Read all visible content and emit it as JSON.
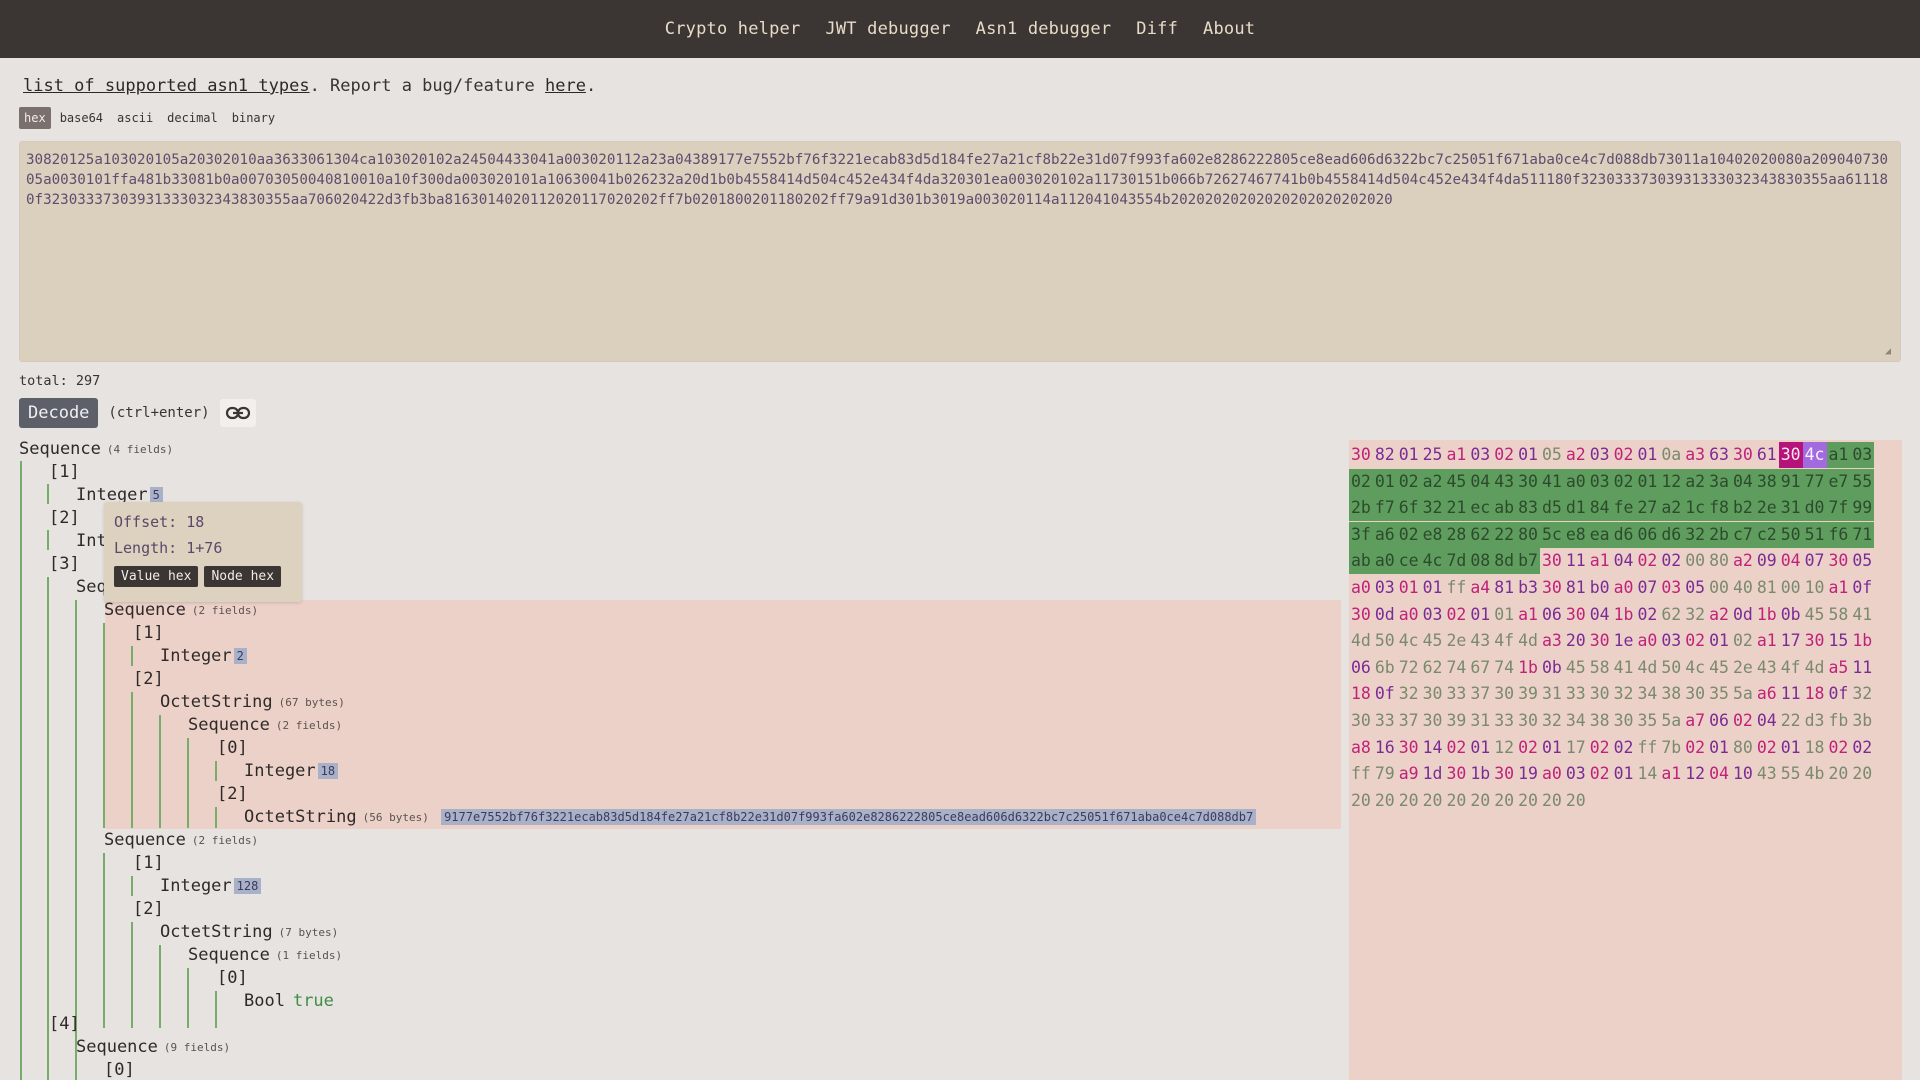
{
  "nav": {
    "items": [
      "Crypto helper",
      "JWT debugger",
      "Asn1 debugger",
      "Diff",
      "About"
    ]
  },
  "info": {
    "types_link": "list of supported asn1 types",
    "middle": ". Report a bug/feature ",
    "here_link": "here",
    "end": "."
  },
  "formats": [
    "hex",
    "base64",
    "ascii",
    "decimal",
    "binary"
  ],
  "input": {
    "value": "30820125a103020105a20302010aa3633061304ca103020102a24504433041a003020112a23a04389177e7552bf76f3221ecab83d5d184fe27a21cf8b22e31d07f993fa602e8286222805ce8ead606d6322bc7c25051f671aba0ce4c7d088db73011a10402020080a20904073005a0030101ffa481b33081b0a00703050040810010a10f300da003020101a10630041b026232a20d1b0b4558414d504c452e434f4da320301ea003020102a11730151b066b72627467741b0b4558414d504c452e434f4da511180f32303337303931333032343830355aa611180f32303337303931333032343830355aa706020422d3fb3ba8163014020112020117020202ff7b0201800201180202ff79a91d301b3019a003020114a112041043554b20202020202020202020202020"
  },
  "total": "total: 297",
  "decode": {
    "label": "Decode",
    "shortcut": "(ctrl+enter)"
  },
  "tooltip": {
    "offset": "Offset: 18",
    "length": "Length: 1+76",
    "value_hex": "Value hex",
    "node_hex": "Node hex"
  },
  "tree": {
    "r0": "Sequence",
    "r0m": "(4 fields)",
    "r1": "[1]",
    "r2": "Integer",
    "r2v": "5",
    "r3": "[2]",
    "r4": "Int",
    "r5": "[3]",
    "r6": "Seq",
    "r7": "Sequence",
    "r7m": "(2 fields)",
    "r8": "[1]",
    "r9": "Integer",
    "r9v": "2",
    "r10": "[2]",
    "r11": "OctetString",
    "r11m": "(67 bytes)",
    "r12": "Sequence",
    "r12m": "(2 fields)",
    "r13": "[0]",
    "r14": "Integer",
    "r14v": "18",
    "r15": "[2]",
    "r16": "OctetString",
    "r16m": "(56 bytes)",
    "r16v": "9177e7552bf76f3221ecab83d5d184fe27a21cf8b22e31d07f993fa602e8286222805ce8ead606d6322bc7c25051f671aba0ce4c7d088db7",
    "r17": "Sequence",
    "r17m": "(2 fields)",
    "r18": "[1]",
    "r19": "Integer",
    "r19v": "128",
    "r20": "[2]",
    "r21": "OctetString",
    "r21m": "(7 bytes)",
    "r22": "Sequence",
    "r22m": "(1 fields)",
    "r23": "[0]",
    "r24": "Bool",
    "r24v": "true",
    "r25": "[4]",
    "r26": "Sequence",
    "r26m": "(9 fields)",
    "r27": "[0]"
  },
  "hex": [
    [
      [
        "30",
        "c1"
      ],
      [
        "82",
        "c2"
      ],
      [
        "01",
        "c2"
      ],
      [
        "25",
        "c2"
      ],
      [
        "a1",
        "c1"
      ],
      [
        "03",
        "c2"
      ],
      [
        "02",
        "c1"
      ],
      [
        "01",
        "c2"
      ],
      [
        "05",
        "c4"
      ],
      [
        "a2",
        "c1"
      ],
      [
        "03",
        "c2"
      ],
      [
        "02",
        "c1"
      ],
      [
        "01",
        "c2"
      ],
      [
        "0a",
        "c4"
      ],
      [
        "a3",
        "c1"
      ],
      [
        "63",
        "c2"
      ],
      [
        "30",
        "c1"
      ],
      [
        "61",
        "c2"
      ],
      [
        "30",
        "sel1"
      ],
      [
        "4c",
        "sel2"
      ],
      [
        "a1",
        "g"
      ],
      [
        "03",
        "g"
      ]
    ],
    [
      [
        "02",
        "g"
      ],
      [
        "01",
        "g"
      ],
      [
        "02",
        "g"
      ],
      [
        "a2",
        "g"
      ],
      [
        "45",
        "g"
      ],
      [
        "04",
        "g"
      ],
      [
        "43",
        "g"
      ],
      [
        "30",
        "g"
      ],
      [
        "41",
        "g"
      ],
      [
        "a0",
        "g"
      ],
      [
        "03",
        "g"
      ],
      [
        "02",
        "g"
      ],
      [
        "01",
        "g"
      ],
      [
        "12",
        "g"
      ],
      [
        "a2",
        "g"
      ],
      [
        "3a",
        "g"
      ],
      [
        "04",
        "g"
      ],
      [
        "38",
        "g"
      ],
      [
        "91",
        "g"
      ],
      [
        "77",
        "g"
      ],
      [
        "e7",
        "g"
      ],
      [
        "55",
        "g"
      ]
    ],
    [
      [
        "2b",
        "g"
      ],
      [
        "f7",
        "g"
      ],
      [
        "6f",
        "g"
      ],
      [
        "32",
        "g"
      ],
      [
        "21",
        "g"
      ],
      [
        "ec",
        "g"
      ],
      [
        "ab",
        "g"
      ],
      [
        "83",
        "g"
      ],
      [
        "d5",
        "g"
      ],
      [
        "d1",
        "g"
      ],
      [
        "84",
        "g"
      ],
      [
        "fe",
        "g"
      ],
      [
        "27",
        "g"
      ],
      [
        "a2",
        "g"
      ],
      [
        "1c",
        "g"
      ],
      [
        "f8",
        "g"
      ],
      [
        "b2",
        "g"
      ],
      [
        "2e",
        "g"
      ],
      [
        "31",
        "g"
      ],
      [
        "d0",
        "g"
      ],
      [
        "7f",
        "g"
      ],
      [
        "99",
        "g"
      ]
    ],
    [
      [
        "3f",
        "g"
      ],
      [
        "a6",
        "g"
      ],
      [
        "02",
        "g"
      ],
      [
        "e8",
        "g"
      ],
      [
        "28",
        "g"
      ],
      [
        "62",
        "g"
      ],
      [
        "22",
        "g"
      ],
      [
        "80",
        "g"
      ],
      [
        "5c",
        "g"
      ],
      [
        "e8",
        "g"
      ],
      [
        "ea",
        "g"
      ],
      [
        "d6",
        "g"
      ],
      [
        "06",
        "g"
      ],
      [
        "d6",
        "g"
      ],
      [
        "32",
        "g"
      ],
      [
        "2b",
        "g"
      ],
      [
        "c7",
        "g"
      ],
      [
        "c2",
        "g"
      ],
      [
        "50",
        "g"
      ],
      [
        "51",
        "g"
      ],
      [
        "f6",
        "g"
      ],
      [
        "71",
        "g"
      ]
    ],
    [
      [
        "ab",
        "g"
      ],
      [
        "a0",
        "g"
      ],
      [
        "ce",
        "g"
      ],
      [
        "4c",
        "g"
      ],
      [
        "7d",
        "g"
      ],
      [
        "08",
        "g"
      ],
      [
        "8d",
        "g"
      ],
      [
        "b7",
        "g"
      ],
      [
        "30",
        "c1"
      ],
      [
        "11",
        "c2"
      ],
      [
        "a1",
        "c1"
      ],
      [
        "04",
        "c2"
      ],
      [
        "02",
        "c1"
      ],
      [
        "02",
        "c2"
      ],
      [
        "00",
        "c4"
      ],
      [
        "80",
        "c4"
      ],
      [
        "a2",
        "c1"
      ],
      [
        "09",
        "c2"
      ],
      [
        "04",
        "c1"
      ],
      [
        "07",
        "c2"
      ],
      [
        "30",
        "c1"
      ],
      [
        "05",
        "c2"
      ]
    ],
    [
      [
        "a0",
        "c1"
      ],
      [
        "03",
        "c2"
      ],
      [
        "01",
        "c1"
      ],
      [
        "01",
        "c2"
      ],
      [
        "ff",
        "c4"
      ],
      [
        "a4",
        "c1"
      ],
      [
        "81",
        "c2"
      ],
      [
        "b3",
        "c2"
      ],
      [
        "30",
        "c1"
      ],
      [
        "81",
        "c2"
      ],
      [
        "b0",
        "c2"
      ],
      [
        "a0",
        "c1"
      ],
      [
        "07",
        "c2"
      ],
      [
        "03",
        "c1"
      ],
      [
        "05",
        "c2"
      ],
      [
        "00",
        "c4"
      ],
      [
        "40",
        "c4"
      ],
      [
        "81",
        "c4"
      ],
      [
        "00",
        "c4"
      ],
      [
        "10",
        "c4"
      ],
      [
        "a1",
        "c1"
      ],
      [
        "0f",
        "c2"
      ]
    ],
    [
      [
        "30",
        "c1"
      ],
      [
        "0d",
        "c2"
      ],
      [
        "a0",
        "c1"
      ],
      [
        "03",
        "c2"
      ],
      [
        "02",
        "c1"
      ],
      [
        "01",
        "c2"
      ],
      [
        "01",
        "c4"
      ],
      [
        "a1",
        "c1"
      ],
      [
        "06",
        "c2"
      ],
      [
        "30",
        "c1"
      ],
      [
        "04",
        "c2"
      ],
      [
        "1b",
        "c1"
      ],
      [
        "02",
        "c2"
      ],
      [
        "62",
        "c4"
      ],
      [
        "32",
        "c4"
      ],
      [
        "a2",
        "c1"
      ],
      [
        "0d",
        "c2"
      ],
      [
        "1b",
        "c1"
      ],
      [
        "0b",
        "c2"
      ],
      [
        "45",
        "c4"
      ],
      [
        "58",
        "c4"
      ],
      [
        "41",
        "c4"
      ]
    ],
    [
      [
        "4d",
        "c4"
      ],
      [
        "50",
        "c4"
      ],
      [
        "4c",
        "c4"
      ],
      [
        "45",
        "c4"
      ],
      [
        "2e",
        "c4"
      ],
      [
        "43",
        "c4"
      ],
      [
        "4f",
        "c4"
      ],
      [
        "4d",
        "c4"
      ],
      [
        "a3",
        "c1"
      ],
      [
        "20",
        "c2"
      ],
      [
        "30",
        "c1"
      ],
      [
        "1e",
        "c2"
      ],
      [
        "a0",
        "c1"
      ],
      [
        "03",
        "c2"
      ],
      [
        "02",
        "c1"
      ],
      [
        "01",
        "c2"
      ],
      [
        "02",
        "c4"
      ],
      [
        "a1",
        "c1"
      ],
      [
        "17",
        "c2"
      ],
      [
        "30",
        "c1"
      ],
      [
        "15",
        "c2"
      ],
      [
        "1b",
        "c1"
      ]
    ],
    [
      [
        "06",
        "c2"
      ],
      [
        "6b",
        "c4"
      ],
      [
        "72",
        "c4"
      ],
      [
        "62",
        "c4"
      ],
      [
        "74",
        "c4"
      ],
      [
        "67",
        "c4"
      ],
      [
        "74",
        "c4"
      ],
      [
        "1b",
        "c1"
      ],
      [
        "0b",
        "c2"
      ],
      [
        "45",
        "c4"
      ],
      [
        "58",
        "c4"
      ],
      [
        "41",
        "c4"
      ],
      [
        "4d",
        "c4"
      ],
      [
        "50",
        "c4"
      ],
      [
        "4c",
        "c4"
      ],
      [
        "45",
        "c4"
      ],
      [
        "2e",
        "c4"
      ],
      [
        "43",
        "c4"
      ],
      [
        "4f",
        "c4"
      ],
      [
        "4d",
        "c4"
      ],
      [
        "a5",
        "c1"
      ],
      [
        "11",
        "c2"
      ]
    ],
    [
      [
        "18",
        "c1"
      ],
      [
        "0f",
        "c2"
      ],
      [
        "32",
        "c4"
      ],
      [
        "30",
        "c4"
      ],
      [
        "33",
        "c4"
      ],
      [
        "37",
        "c4"
      ],
      [
        "30",
        "c4"
      ],
      [
        "39",
        "c4"
      ],
      [
        "31",
        "c4"
      ],
      [
        "33",
        "c4"
      ],
      [
        "30",
        "c4"
      ],
      [
        "32",
        "c4"
      ],
      [
        "34",
        "c4"
      ],
      [
        "38",
        "c4"
      ],
      [
        "30",
        "c4"
      ],
      [
        "35",
        "c4"
      ],
      [
        "5a",
        "c4"
      ],
      [
        "a6",
        "c1"
      ],
      [
        "11",
        "c2"
      ],
      [
        "18",
        "c1"
      ],
      [
        "0f",
        "c2"
      ],
      [
        "32",
        "c4"
      ]
    ],
    [
      [
        "30",
        "c4"
      ],
      [
        "33",
        "c4"
      ],
      [
        "37",
        "c4"
      ],
      [
        "30",
        "c4"
      ],
      [
        "39",
        "c4"
      ],
      [
        "31",
        "c4"
      ],
      [
        "33",
        "c4"
      ],
      [
        "30",
        "c4"
      ],
      [
        "32",
        "c4"
      ],
      [
        "34",
        "c4"
      ],
      [
        "38",
        "c4"
      ],
      [
        "30",
        "c4"
      ],
      [
        "35",
        "c4"
      ],
      [
        "5a",
        "c4"
      ],
      [
        "a7",
        "c1"
      ],
      [
        "06",
        "c2"
      ],
      [
        "02",
        "c1"
      ],
      [
        "04",
        "c2"
      ],
      [
        "22",
        "c4"
      ],
      [
        "d3",
        "c4"
      ],
      [
        "fb",
        "c4"
      ],
      [
        "3b",
        "c4"
      ]
    ],
    [
      [
        "a8",
        "c1"
      ],
      [
        "16",
        "c2"
      ],
      [
        "30",
        "c1"
      ],
      [
        "14",
        "c2"
      ],
      [
        "02",
        "c1"
      ],
      [
        "01",
        "c2"
      ],
      [
        "12",
        "c4"
      ],
      [
        "02",
        "c1"
      ],
      [
        "01",
        "c2"
      ],
      [
        "17",
        "c4"
      ],
      [
        "02",
        "c1"
      ],
      [
        "02",
        "c2"
      ],
      [
        "ff",
        "c4"
      ],
      [
        "7b",
        "c4"
      ],
      [
        "02",
        "c1"
      ],
      [
        "01",
        "c2"
      ],
      [
        "80",
        "c4"
      ],
      [
        "02",
        "c1"
      ],
      [
        "01",
        "c2"
      ],
      [
        "18",
        "c4"
      ],
      [
        "02",
        "c1"
      ],
      [
        "02",
        "c2"
      ]
    ],
    [
      [
        "ff",
        "c4"
      ],
      [
        "79",
        "c4"
      ],
      [
        "a9",
        "c1"
      ],
      [
        "1d",
        "c2"
      ],
      [
        "30",
        "c1"
      ],
      [
        "1b",
        "c2"
      ],
      [
        "30",
        "c1"
      ],
      [
        "19",
        "c2"
      ],
      [
        "a0",
        "c1"
      ],
      [
        "03",
        "c2"
      ],
      [
        "02",
        "c1"
      ],
      [
        "01",
        "c2"
      ],
      [
        "14",
        "c4"
      ],
      [
        "a1",
        "c1"
      ],
      [
        "12",
        "c2"
      ],
      [
        "04",
        "c1"
      ],
      [
        "10",
        "c2"
      ],
      [
        "43",
        "c4"
      ],
      [
        "55",
        "c4"
      ],
      [
        "4b",
        "c4"
      ],
      [
        "20",
        "c4"
      ],
      [
        "20",
        "c4"
      ]
    ],
    [
      [
        "20",
        "c4"
      ],
      [
        "20",
        "c4"
      ],
      [
        "20",
        "c4"
      ],
      [
        "20",
        "c4"
      ],
      [
        "20",
        "c4"
      ],
      [
        "20",
        "c4"
      ],
      [
        "20",
        "c4"
      ],
      [
        "20",
        "c4"
      ],
      [
        "20",
        "c4"
      ],
      [
        "20",
        "c4"
      ]
    ]
  ]
}
